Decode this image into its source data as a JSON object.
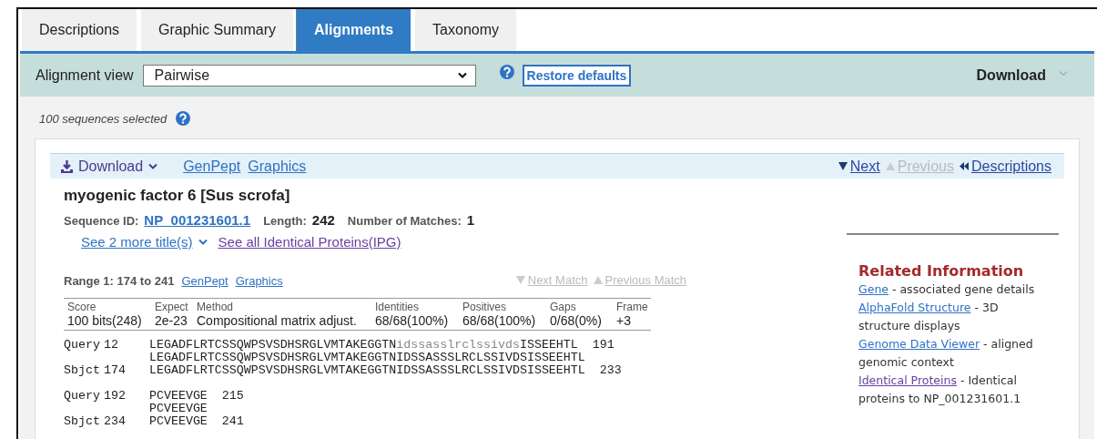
{
  "tabs": [
    {
      "label": "Descriptions",
      "selected": false
    },
    {
      "label": "Graphic Summary",
      "selected": false
    },
    {
      "label": "Alignments",
      "selected": true
    },
    {
      "label": "Taxonomy",
      "selected": false
    }
  ],
  "toolbar": {
    "label": "Alignment view",
    "view": "Pairwise",
    "restore_button": "Restore defaults",
    "download": "Download"
  },
  "selection_note": "100 sequences selected",
  "hit": {
    "bar": {
      "download": "Download",
      "links": [
        "GenPept",
        "Graphics"
      ],
      "nav": [
        {
          "label": "Next",
          "kind": "next",
          "disabled": false
        },
        {
          "label": "Previous",
          "kind": "previous",
          "disabled": true
        },
        {
          "label": "Descriptions",
          "kind": "back",
          "disabled": false
        }
      ]
    },
    "title": "myogenic factor 6 [Sus scrofa]",
    "sequence_id_label": "Sequence ID:",
    "sequence_id": "NP_001231601.1",
    "length_label": "Length:",
    "length": "242",
    "matches_label": "Number of Matches:",
    "matches": "1",
    "more_titles": "See 2 more title(s)",
    "identical_link": {
      "label": "See all Identical Proteins(IPG)",
      "visited": true
    },
    "range": {
      "label": "Range 1: 174 to 241",
      "links": [
        "GenPept",
        "Graphics"
      ],
      "nav": [
        {
          "label": "Next Match",
          "kind": "next",
          "disabled": true
        },
        {
          "label": "Previous Match",
          "kind": "previous",
          "disabled": true
        }
      ]
    },
    "stats": {
      "columns": [
        "Score",
        "Expect",
        "Method",
        "Identities",
        "Positives",
        "Gaps",
        "Frame"
      ],
      "values": [
        "100 bits(248)",
        "2e-23",
        "Compositional matrix adjust.",
        "68/68(100%)",
        "68/68(100%)",
        "0/68(0%)",
        "+3"
      ]
    },
    "alignment": [
      [
        {
          "kind": "query",
          "label": "Query",
          "start": "12",
          "segments": [
            {
              "text": "LEGADFLRTCSSQWPSVSDHSRGLVMTAKEGGTN",
              "masked": false
            },
            {
              "text": "idssasslrclssivds",
              "masked": true
            },
            {
              "text": "ISSEEHTL",
              "masked": false
            }
          ],
          "end": "191"
        },
        {
          "kind": "match",
          "text": "LEGADFLRTCSSQWPSVSDHSRGLVMTAKEGGTNIDSSASSSLRCLSSIVDSISSEEHTL"
        },
        {
          "kind": "subject",
          "label": "Sbjct",
          "start": "174",
          "segments": [
            {
              "text": "LEGADFLRTCSSQWPSVSDHSRGLVMTAKEGGTNIDSSASSSLRCLSSIVDSISSEEHTL",
              "masked": false
            }
          ],
          "end": "233"
        }
      ],
      [
        {
          "kind": "query",
          "label": "Query",
          "start": "192",
          "segments": [
            {
              "text": "PCVEEVGE",
              "masked": false
            }
          ],
          "end": "215"
        },
        {
          "kind": "match",
          "text": "PCVEEVGE"
        },
        {
          "kind": "subject",
          "label": "Sbjct",
          "start": "234",
          "segments": [
            {
              "text": "PCVEEVGE",
              "masked": false
            }
          ],
          "end": "241"
        }
      ]
    ],
    "related": {
      "title": "Related Information",
      "items": [
        {
          "link": "Gene",
          "description": " - associated gene details",
          "visited": false
        },
        {
          "link": "AlphaFold Structure",
          "description": " - 3D structure displays",
          "visited": false
        },
        {
          "link": "Genome Data Viewer",
          "description": " - aligned genomic context",
          "visited": false
        },
        {
          "link": "Identical Proteins",
          "description": " - Identical proteins to NP_001231601.1",
          "visited": true
        }
      ]
    }
  }
}
